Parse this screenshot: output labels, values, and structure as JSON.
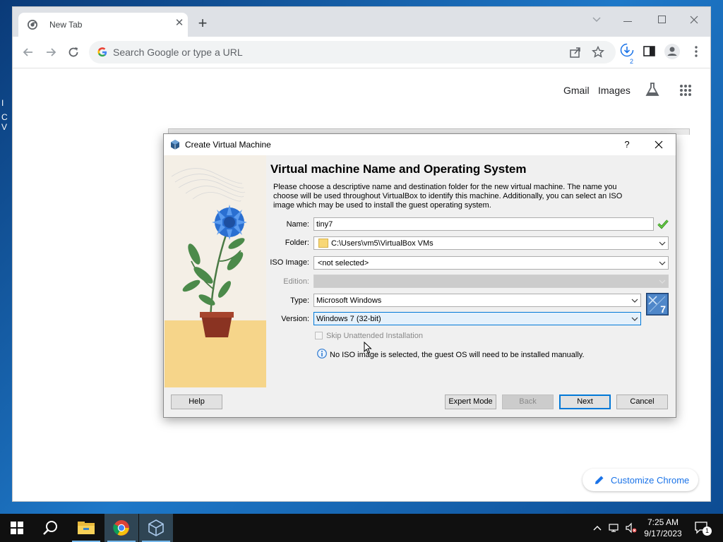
{
  "desktop": {
    "fragments": [
      "I",
      "C",
      "V"
    ]
  },
  "browser": {
    "tab": {
      "title": "New Tab"
    },
    "omnibox": {
      "placeholder": "Search Google or type a URL"
    },
    "download_count": "2",
    "ntp": {
      "gmail": "Gmail",
      "images": "Images",
      "customize": "Customize Chrome"
    }
  },
  "dialog": {
    "title": "Create Virtual Machine",
    "help_glyph": "?",
    "heading": "Virtual machine Name and Operating System",
    "description": "Please choose a descriptive name and destination folder for the new virtual machine. The name you choose will be used throughout VirtualBox to identify this machine. Additionally, you can select an ISO image which may be used to install the guest operating system.",
    "fields": {
      "name_label": "Name:",
      "name_value": "tiny7",
      "folder_label": "Folder:",
      "folder_value": "C:\\Users\\vm5\\VirtualBox VMs",
      "iso_label": "ISO Image:",
      "iso_value": "<not selected>",
      "edition_label": "Edition:",
      "edition_value": "",
      "type_label": "Type:",
      "type_value": "Microsoft Windows",
      "version_label": "Version:",
      "version_value": "Windows 7 (32-bit)"
    },
    "os_badge": "7",
    "skip_unattended_label": "Skip Unattended Installation",
    "info_text": "No ISO image is selected, the guest OS will need to be installed manually.",
    "buttons": {
      "help": "Help",
      "expert": "Expert Mode",
      "back": "Back",
      "next": "Next",
      "cancel": "Cancel"
    }
  },
  "taskbar": {
    "time": "7:25 AM",
    "date": "9/17/2023",
    "notification_count": "1"
  },
  "colors": {
    "accent": "#0078d7",
    "chrome_link": "#1a73e8",
    "taskbar": "#101010"
  }
}
